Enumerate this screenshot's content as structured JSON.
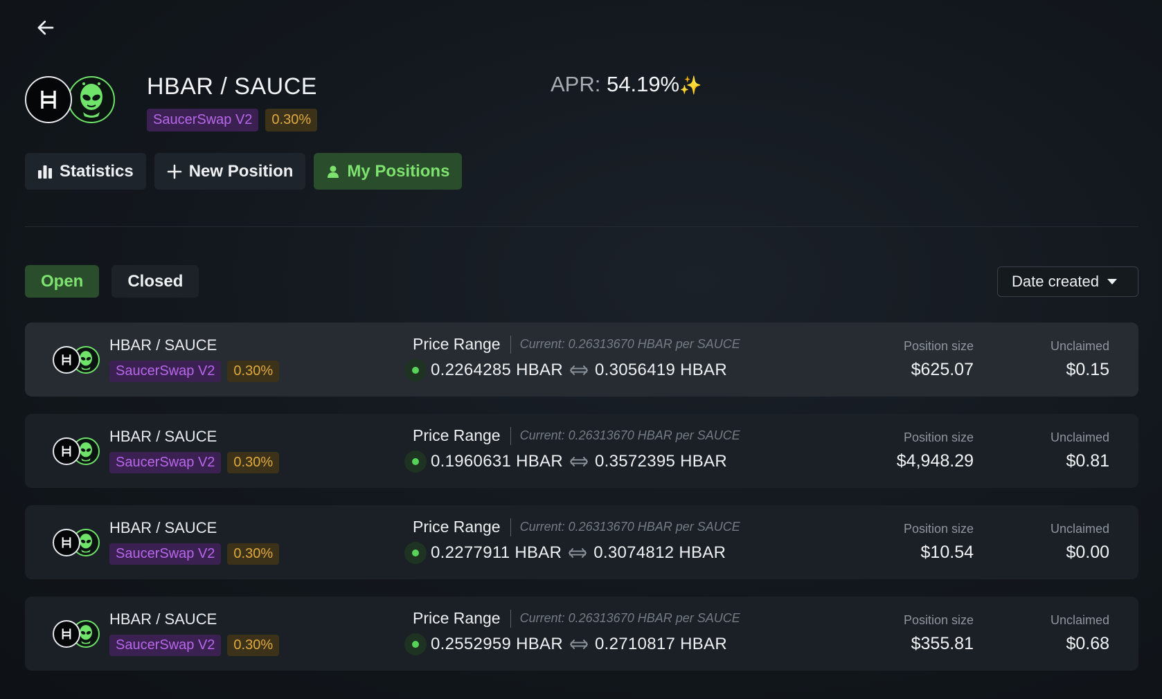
{
  "header": {
    "pair": "HBAR / SAUCE",
    "dex": "SaucerSwap V2",
    "fee": "0.30%",
    "apr_label": "APR:",
    "apr_value": "54.19%",
    "apr_icon": "✨"
  },
  "nav": {
    "tabs": [
      {
        "label": "Statistics",
        "icon": "bar-chart-icon"
      },
      {
        "label": "New Position",
        "icon": "plus-icon"
      },
      {
        "label": "My Positions",
        "icon": "user-icon",
        "active": true
      }
    ]
  },
  "filters": {
    "open_label": "Open",
    "closed_label": "Closed",
    "sort_label": "Date created"
  },
  "labels": {
    "price_range": "Price Range",
    "position_size": "Position size",
    "unclaimed": "Unclaimed"
  },
  "positions": [
    {
      "pair": "HBAR / SAUCE",
      "dex": "SaucerSwap V2",
      "fee": "0.30%",
      "current": "Current: 0.26313670 HBAR per SAUCE",
      "min": "0.2264285 HBAR",
      "max": "0.3056419 HBAR",
      "size": "$625.07",
      "unclaimed": "$0.15"
    },
    {
      "pair": "HBAR / SAUCE",
      "dex": "SaucerSwap V2",
      "fee": "0.30%",
      "current": "Current: 0.26313670 HBAR per SAUCE",
      "min": "0.1960631 HBAR",
      "max": "0.3572395 HBAR",
      "size": "$4,948.29",
      "unclaimed": "$0.81"
    },
    {
      "pair": "HBAR / SAUCE",
      "dex": "SaucerSwap V2",
      "fee": "0.30%",
      "current": "Current: 0.26313670 HBAR per SAUCE",
      "min": "0.2277911 HBAR",
      "max": "0.3074812 HBAR",
      "size": "$10.54",
      "unclaimed": "$0.00"
    },
    {
      "pair": "HBAR / SAUCE",
      "dex": "SaucerSwap V2",
      "fee": "0.30%",
      "current": "Current: 0.26313670 HBAR per SAUCE",
      "min": "0.2552959 HBAR",
      "max": "0.2710817 HBAR",
      "size": "$355.81",
      "unclaimed": "$0.68"
    }
  ],
  "colors": {
    "accent_green": "#7ee26f",
    "dex_purple": "#b867ea",
    "fee_gold": "#e0a93f",
    "in_range": "#58d35a"
  }
}
